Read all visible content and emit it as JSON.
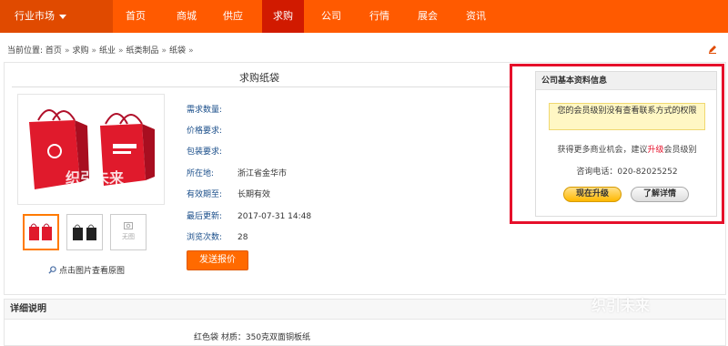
{
  "topnav": {
    "market_label": "行业市场",
    "items": [
      "首页",
      "商城",
      "供应",
      "求购",
      "公司",
      "行情",
      "展会",
      "资讯"
    ]
  },
  "breadcrumb": {
    "prefix": "当前位置:",
    "items": [
      "首页",
      "求购",
      "纸业",
      "纸类制品",
      "纸袋"
    ],
    "separator": "»"
  },
  "product": {
    "title": "求购纸袋",
    "zoom_label": "点击图片查看原图",
    "noimage_label": "无图",
    "watermark": "织引未来",
    "fields": [
      {
        "label": "需求数量:",
        "value": ""
      },
      {
        "label": "价格要求:",
        "value": ""
      },
      {
        "label": "包装要求:",
        "value": ""
      },
      {
        "label": "所在地:",
        "value": "浙江省金华市"
      },
      {
        "label": "有效期至:",
        "value": "长期有效"
      },
      {
        "label": "最后更新:",
        "value": "2017-07-31 14:48"
      },
      {
        "label": "浏览次数:",
        "value": "28"
      }
    ],
    "quote_button": "发送报价"
  },
  "company": {
    "header": "公司基本资料信息",
    "warning": "您的会员级别没有查看联系方式的权限",
    "more_prefix": "获得更多商业机会，建议",
    "more_highlight": "升级",
    "more_suffix": "会员级别",
    "phone": "咨询电话：020-82025252",
    "upgrade_button": "现在升级",
    "learn_button": "了解详情"
  },
  "detail": {
    "header": "详细说明",
    "text": "红色袋 材质：350克双面铜板纸"
  },
  "colors": {
    "nav_bg": "#ff5a00",
    "nav_active": "#d11a00",
    "highlight_frame": "#e6102a",
    "button_orange": "#ff6a00"
  }
}
